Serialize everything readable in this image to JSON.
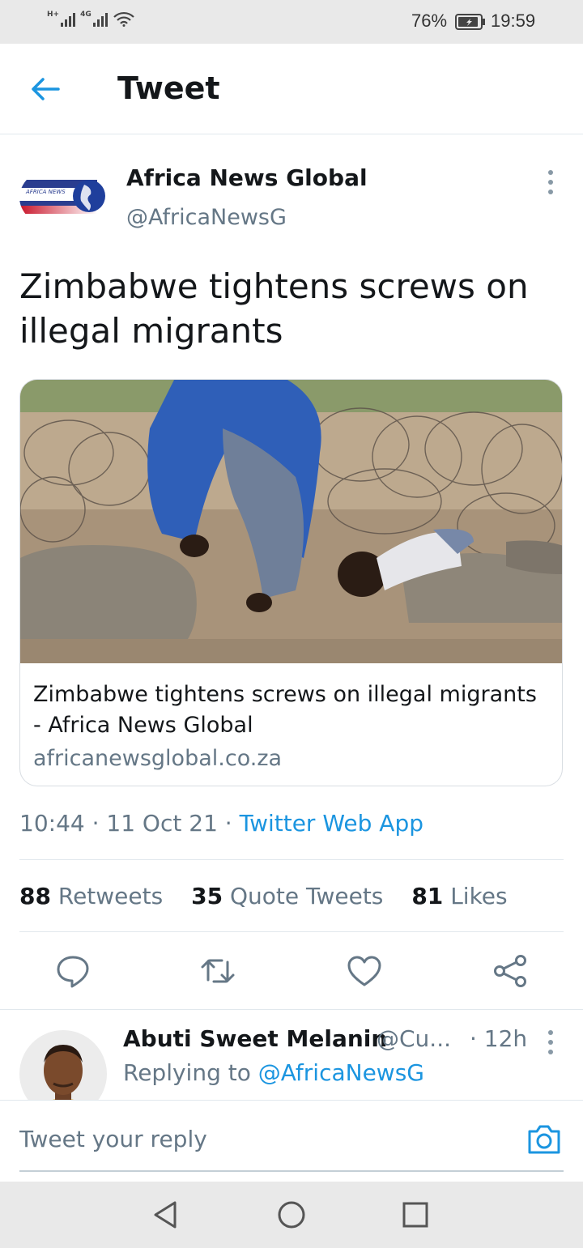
{
  "status_bar": {
    "network_1": "H+",
    "network_2": "4G",
    "battery": "76%",
    "time": "19:59"
  },
  "header": {
    "title": "Tweet",
    "back_icon": "arrow-left-icon"
  },
  "tweet": {
    "author_name": "Africa News Global",
    "author_handle": "@AfricaNewsG",
    "logo_text_1": "AFRICA NEWS",
    "logo_text_2": "GLOBAL",
    "text": "Zimbabwe tightens screws on illegal migrants",
    "card": {
      "title": "Zimbabwe tightens screws on illegal migrants - Africa News Global",
      "domain": "africanewsglobal.co.za"
    },
    "time": "10:44",
    "date": "11 Oct 21",
    "source": "Twitter Web App",
    "stats": {
      "retweets_count": "88",
      "retweets_label": "Retweets",
      "quotes_count": "35",
      "quotes_label": "Quote Tweets",
      "likes_count": "81",
      "likes_label": "Likes"
    },
    "actions": [
      "reply-icon",
      "retweet-icon",
      "like-icon",
      "share-icon"
    ]
  },
  "reply": {
    "author_name": "Abuti Sweet Melanin",
    "author_handle": "@Cu...",
    "time": "· 12h",
    "replying_to_label": "Replying to",
    "replying_to_handle": "@AfricaNewsG"
  },
  "compose": {
    "placeholder": "Tweet your reply"
  },
  "colors": {
    "accent": "#1b95e0",
    "secondary_text": "#657786",
    "divider": "#e1e8ed"
  }
}
